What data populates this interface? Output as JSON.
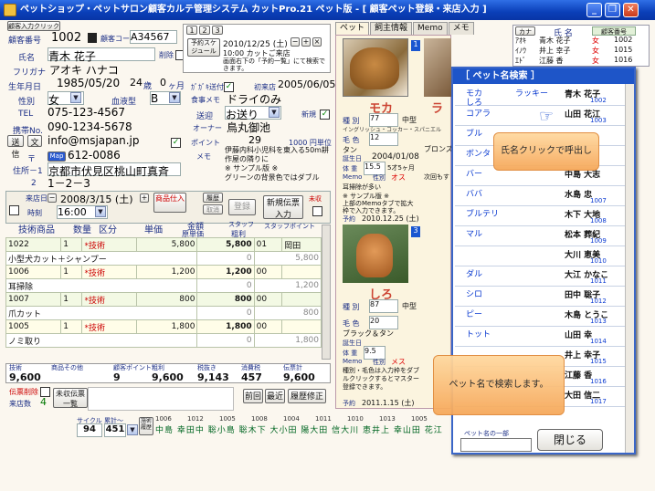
{
  "window": {
    "title": "ペットショップ・ペットサロン顧客カルテ管理システム カットPro.21 ペット版 - [ 顧客ペット登録・来店入力 ]"
  },
  "colors": {
    "title_blue": "#0a3fb8",
    "panel_head": "#1e55c8",
    "accent_red": "#d00000"
  },
  "customer": {
    "new_button": "顧客入力クリック",
    "no_label": "顧客番号",
    "no": "1002",
    "code_label": "顧客コード",
    "code": "A34567",
    "name_label": "氏名",
    "name": "青木 花子",
    "delete_label": "削除",
    "kana_label": "フリガナ",
    "kana": "アオキ ハナコ",
    "birth_label": "生年月日",
    "birth": "1985/05/20",
    "age": "24",
    "age_unit": "歳",
    "month": "0",
    "month_unit": "ヶ月",
    "sex_label": "性別",
    "sex": "女",
    "blood_label": "血液型",
    "blood": "B",
    "tel_label": "TEL",
    "tel": "075-123-4567",
    "mobile_label": "携帯No.",
    "mobile": "090-1234-5678",
    "mail_btn1": "送信",
    "mail_btn2": "文",
    "email": "info@msjapan.jp",
    "zip_label": "〒",
    "map_btn": "Map",
    "zip": "612-0086",
    "addr_label1": "住所－1",
    "addr1": "京都市伏見区桃山町真斉",
    "addr_label2": "2",
    "addr2": "1－2－3",
    "dm_label": "ｶﾞｶﾞｷ送付",
    "first_visit_label": "初来店",
    "first_visit": "2005/06/05",
    "food_label": "食事メモ",
    "food": "ドライのみ",
    "send_label": "送迎",
    "send": "お送り",
    "new_label": "新規",
    "owner_label": "オーナー",
    "owner": "鳥丸御池",
    "point_label": "ポイント",
    "points": "29",
    "point_note": "1000 円単位",
    "memo_label": "メモ",
    "memo": "伊藤内科小児科を東入る50m耕作屋の隣りに\n※ サンプル版 ※\nグリーンの背景色ではダブル"
  },
  "reservation": {
    "tabs": [
      "1",
      "2",
      "3"
    ],
    "button": "予約スケジュール",
    "date": "2010/12/25 (土)",
    "time": "10:00",
    "text": "カットご来店",
    "note": "画面右下の「予約一覧」にて検索できます。"
  },
  "visit": {
    "visit_label": "来店日",
    "date": "2008/3/15 (土)",
    "time_label": "時刻",
    "time": "16:00",
    "goods_btn": "商品仕入",
    "history_btn": "履歴",
    "cancel_btn": "取消",
    "register_btn": "登録",
    "new_slip_btn": "新規伝票入力",
    "unpaid_label": "未収",
    "columns": [
      "技術商品",
      "数量",
      "区分",
      "単価",
      "金額",
      "スタッフ",
      "スタッフポイント"
    ],
    "subcolumns": [
      "原単価",
      "粗利"
    ],
    "rows": [
      {
        "code": "1022",
        "qty": "1",
        "kind": "*技術",
        "price": "5,800",
        "amount": "5,800",
        "staff": "01",
        "name": "小型犬カット＋シャンプー",
        "cost": "0",
        "profit": "5,800",
        "sname": "岡田"
      },
      {
        "code": "1006",
        "qty": "1",
        "kind": "*技術",
        "price": "1,200",
        "amount": "1,200",
        "staff": "00",
        "name": "耳掃除",
        "cost": "0",
        "profit": "1,200",
        "sname": ""
      },
      {
        "code": "1007",
        "qty": "1",
        "kind": "*技術",
        "price": "800",
        "amount": "800",
        "staff": "00",
        "name": "爪カット",
        "cost": "0",
        "profit": "800",
        "sname": ""
      },
      {
        "code": "1005",
        "qty": "1",
        "kind": "*技術",
        "price": "1,800",
        "amount": "1,800",
        "staff": "00",
        "name": "ノミ取り",
        "cost": "0",
        "profit": "1,800",
        "sname": ""
      }
    ],
    "totals_headers": [
      "技術",
      "商品その他",
      "顧客ポイント",
      "粗利",
      "税抜き",
      "消費税",
      "伝票計"
    ],
    "totals": [
      "9,600",
      "",
      "9",
      "9,600",
      "9,143",
      "457",
      "9,600"
    ],
    "slip_delete": "伝票削除",
    "unpaid_btn": "未収伝票一覧",
    "memo_label": "メモ",
    "visit_count_label": "来店数",
    "visit_count": "4",
    "nav": [
      "前回",
      "最近",
      "履歴修正"
    ],
    "cycle_label": "サイクル",
    "avg_label": "累計～",
    "cycle": "94",
    "cycle2": "451",
    "history_label": "施術履歴",
    "history_codes": [
      "1006",
      "1012",
      "1005",
      "1008",
      "1004",
      "1011",
      "1010",
      "1013",
      "1005"
    ],
    "history_names": "中島 幸田中 聡小島 聡木下 大小田 陽大田 信大川 恵井上 幸山田 花江"
  },
  "pets": {
    "tabs": [
      "ペット",
      "飼主情報",
      "Memo",
      "メモ"
    ],
    "pet1": {
      "no": "1",
      "name": "モカ",
      "kind_label": "種 別",
      "kind": "77",
      "size": "中型",
      "breed": "イングリッシュ・コッカー・スパニエル",
      "color_label": "毛 色",
      "color": "12",
      "coat": "タン",
      "birth_label": "誕生日",
      "birth": "2004/01/08",
      "weight_label": "体 重",
      "weight": "15.5",
      "age": "5才5ヶ月",
      "memo_label": "Memo",
      "sex_label": "性別",
      "sex": "オス",
      "note_title": "耳掃除が多い",
      "sample": "※ サンプル版 ※",
      "note": "上部のMemoタブで拡大枠で入力できます。",
      "reserve_label": "予約",
      "reserve": "2010.12.25 (土)"
    },
    "pet2": {
      "no": "2",
      "name": "ラ",
      "breed": "ブロンズ",
      "note": "次回もす"
    },
    "pet3": {
      "no": "3",
      "name": "しろ",
      "kind_label": "種 別",
      "kind": "87",
      "size": "中型",
      "color_label": "毛 色",
      "color": "20",
      "coat": "ブラック＆タン",
      "birth_label": "誕生日",
      "birth": "",
      "weight_label": "体 重",
      "weight": "9.5",
      "memo_label": "Memo",
      "sex_label": "性別",
      "sex": "メス",
      "note": "種別・毛色は入力枠をダブルクリックするとマスター登録できます。",
      "reserve_label": "予約",
      "reserve": "2011.1.15 (土)"
    }
  },
  "customer_list": {
    "tab": "カナ",
    "header": "氏 名",
    "header2": "顧客番号",
    "rows": [
      {
        "kana": "ｱｵｷ",
        "name": "青木 花子",
        "sex": "女",
        "no": "1002"
      },
      {
        "kana": "ｲﾉｳ",
        "name": "井上 幸子",
        "sex": "女",
        "no": "1015"
      },
      {
        "kana": "ｴﾄﾞ",
        "name": "江藤 香",
        "sex": "女",
        "no": "1016"
      }
    ]
  },
  "search": {
    "title": "［ ペット名検索 ］",
    "rows": [
      {
        "pet": "モカ",
        "pet2": "しろ",
        "mid": "ラッキー",
        "name": "青木 花子",
        "no": "1002"
      },
      {
        "pet": "コアラ",
        "pet2": "",
        "mid": "",
        "name": "山田 花江",
        "no": "1003"
      },
      {
        "pet": "ブル",
        "pet2": "",
        "mid": "",
        "name": "",
        "no": ""
      },
      {
        "pet": "ボンタ",
        "pet2": "",
        "mid": "",
        "name": "",
        "no": ""
      },
      {
        "pet": "バー",
        "pet2": "",
        "mid": "",
        "name": "中島 大志",
        "no": ""
      },
      {
        "pet": "ババ",
        "pet2": "",
        "mid": "",
        "name": "水島 忠",
        "no": "1007"
      },
      {
        "pet": "ブルテリ",
        "pet2": "",
        "mid": "",
        "name": "木下 大地",
        "no": "1008"
      },
      {
        "pet": "マル",
        "pet2": "",
        "mid": "",
        "name": "松本 葬紀",
        "no": "1009"
      },
      {
        "pet": "",
        "pet2": "",
        "mid": "",
        "name": "大川 恵美",
        "no": "1010"
      },
      {
        "pet": "ダル",
        "pet2": "",
        "mid": "",
        "name": "大江 かなこ",
        "no": "1011"
      },
      {
        "pet": "シロ",
        "pet2": "",
        "mid": "",
        "name": "田中 聡子",
        "no": "1012"
      },
      {
        "pet": "ピー",
        "pet2": "",
        "mid": "",
        "name": "木島 とうこ",
        "no": "1013"
      },
      {
        "pet": "トット",
        "pet2": "",
        "mid": "",
        "name": "山田 幸",
        "no": "1014"
      },
      {
        "pet": "",
        "pet2": "",
        "mid": "",
        "name": "井上 幸子",
        "no": "1015"
      },
      {
        "pet": "",
        "pet2": "",
        "mid": "",
        "name": "江藤 香",
        "no": "1016"
      },
      {
        "pet": "",
        "pet2": "",
        "mid": "",
        "name": "大田 信二",
        "no": "1017"
      }
    ],
    "input_label": "ペット名の一部",
    "close": "閉じる",
    "bubble1": "氏名クリックで呼出し",
    "bubble2": "ペット名で検索します。"
  }
}
